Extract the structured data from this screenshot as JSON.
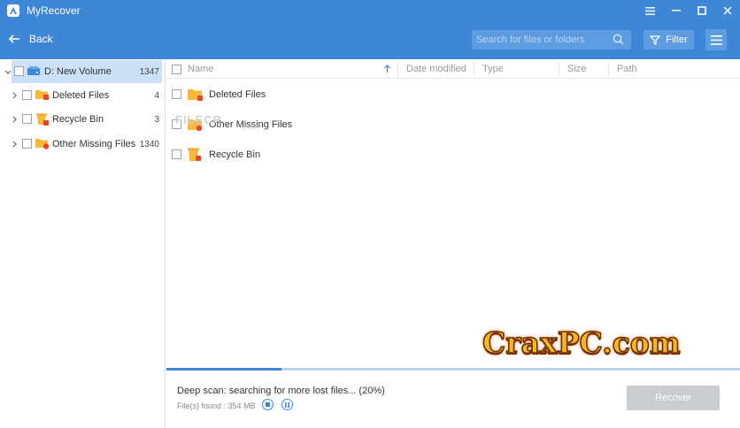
{
  "app": {
    "title": "MyRecover"
  },
  "toolbar": {
    "back_label": "Back",
    "search_placeholder": "Search for files or folders",
    "filter_label": "Filter"
  },
  "sidebar": {
    "items": [
      {
        "label": "D: New Volume",
        "count": "1347",
        "icon": "drive-icon",
        "selected": true
      },
      {
        "label": "Deleted Files",
        "count": "4",
        "icon": "deleted-folder-icon"
      },
      {
        "label": "Recycle Bin",
        "count": "3",
        "icon": "recycle-bin-icon"
      },
      {
        "label": "Other Missing Files",
        "count": "1340",
        "icon": "missing-folder-icon"
      }
    ]
  },
  "list": {
    "columns": [
      "Name",
      "Date modified",
      "Type",
      "Size",
      "Path"
    ],
    "rows": [
      {
        "name": "Deleted Files",
        "icon": "deleted-folder-icon"
      },
      {
        "name": "Other Missing Files",
        "icon": "missing-folder-icon"
      },
      {
        "name": "Recycle Bin",
        "icon": "recycle-bin-icon"
      }
    ]
  },
  "scan": {
    "status": "Deep scan: searching for more lost files... (20%)",
    "files_found": "File(s) found : 354 MB",
    "progress": 0.2
  },
  "actions": {
    "recover_label": "Recover"
  },
  "watermarks": {
    "filecr": "FILECR",
    "filecr_sub": ".com",
    "crax": "CraxPC.com"
  },
  "colors": {
    "accent": "#3d86d8",
    "folder": "#f6b93b",
    "badge": "#e8472f"
  }
}
